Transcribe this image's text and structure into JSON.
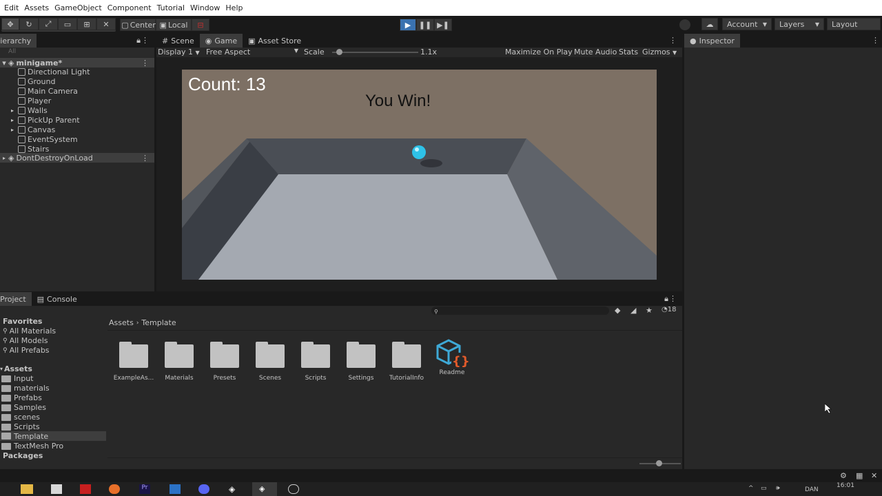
{
  "menu": [
    "Edit",
    "Assets",
    "GameObject",
    "Component",
    "Tutorial",
    "Window",
    "Help"
  ],
  "toolbar": {
    "pivot": "Center",
    "space": "Local",
    "account": "Account",
    "layers": "Layers",
    "layout": "Layout"
  },
  "hierarchy": {
    "tab": "Hierarchy",
    "search_placeholder": "All",
    "scene": "minigame*",
    "items": [
      "Directional Light",
      "Ground",
      "Main Camera",
      "Player",
      "Walls",
      "PickUp Parent",
      "Canvas",
      "EventSystem",
      "Stairs"
    ],
    "ddol": "DontDestroyOnLoad"
  },
  "view_tabs": [
    "Scene",
    "Game",
    "Asset Store"
  ],
  "game_bar": {
    "display": "Display 1",
    "aspect": "Free Aspect",
    "scale_label": "Scale",
    "scale_value": "1.1x",
    "scale_fraction": 0.05,
    "maximize": "Maximize On Play",
    "mute": "Mute Audio",
    "stats": "Stats",
    "gizmos": "Gizmos"
  },
  "game": {
    "count": "Count: 13",
    "win": "You Win!"
  },
  "inspector": {
    "tab": "Inspector"
  },
  "project": {
    "tabs": [
      "Project",
      "Console"
    ],
    "breadcrumb": [
      "Assets",
      "Template"
    ],
    "count": "18",
    "favorites_title": "Favorites",
    "favorites": [
      "All Materials",
      "All Models",
      "All Prefabs"
    ],
    "assets_title": "Assets",
    "folders": [
      "Input",
      "materials",
      "Prefabs",
      "Samples",
      "scenes",
      "Scripts",
      "Template",
      "TextMesh Pro"
    ],
    "selected_folder": "Template",
    "packages_title": "Packages",
    "grid": [
      "ExampleAs...",
      "Materials",
      "Presets",
      "Scenes",
      "Scripts",
      "Settings",
      "TutorialInfo",
      "Readme"
    ]
  },
  "taskbar": {
    "lang": "DAN",
    "time": "16:01"
  },
  "colors": {
    "accent": "#3a72b0",
    "sky": "#7d7064",
    "floor": "#a4a9b1",
    "ball": "#2ec2e8",
    "readme_orange": "#e05a2b",
    "readme_blue": "#3ea9d6"
  }
}
